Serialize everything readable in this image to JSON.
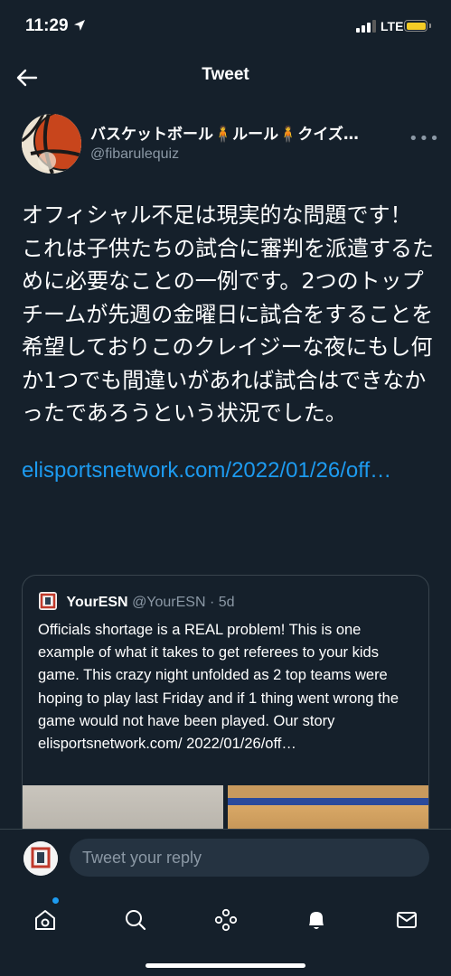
{
  "status_bar": {
    "time": "11:29",
    "network": "LTE",
    "battery_color": "#f5cc26"
  },
  "header": {
    "title": "Tweet",
    "back_icon": "arrow-left-icon"
  },
  "tweet": {
    "author_name": "バスケットボール🧍ルール🧍クイズ…",
    "handle": "@fibarulequiz",
    "more_icon": "more-horizontal-icon",
    "text": "オフィシャル不足は現実的な問題です！ これは子供たちの試合に審判を派遣するために必要なことの一例です。2つのトップチームが先週の金曜日に試合をすることを希望しておりこのクレイジーな夜にもし何か1つでも間違いがあれば試合はできなかったであろうという状況でした。",
    "link": "elisportsnetwork.com/2022/01/26/off…"
  },
  "quoted_tweet": {
    "name": "YourESN",
    "handle": "@YourESN",
    "date": "· 5d",
    "text": "Officials shortage is a REAL problem! This is one example of what it takes to get referees to your kids game. This crazy night unfolded as 2 top teams were hoping to play last Friday and if 1 thing went wrong the game would not have been played. Our story elisportsnetwork.com/ 2022/01/26/off…"
  },
  "reply": {
    "placeholder": "Tweet your reply"
  },
  "bottom_nav": {
    "items": [
      "home-icon",
      "search-icon",
      "spaces-icon",
      "notifications-icon",
      "messages-icon"
    ],
    "accent": "#1d9bf0"
  }
}
